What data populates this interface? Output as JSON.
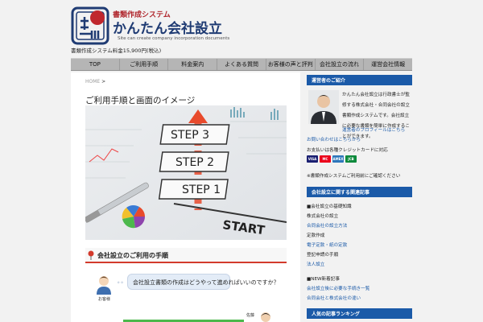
{
  "header": {
    "logo_stamp_text": "書類",
    "subtitle": "書類作成システム",
    "title": "かんたん会社設立",
    "tagline": "Site can create company incorporation documents",
    "price_note": "書類作成システム料金15,900円(税込)"
  },
  "nav": {
    "items": [
      "TOP",
      "ご利用手順",
      "料金案内",
      "よくある質問",
      "お客様の声と評判",
      "会社設立の流れ",
      "運営会社情報"
    ]
  },
  "main": {
    "breadcrumb_home": "HOME",
    "breadcrumb_sep": ">",
    "page_title": "ご利用手順と画面のイメージ",
    "hero_steps": [
      "STEP 3",
      "STEP 2",
      "STEP 1",
      "START"
    ],
    "section_title": "会社設立のご利用の手順",
    "dialog": {
      "left_name": "お客様",
      "left_text": "会社設立書類の作成はどうやって進めればいいのですか？",
      "right_name": "佐藤"
    }
  },
  "sidebar": {
    "head1": "運営者のご紹介",
    "profile_text": "かんたん会社設立は行政書士が監修する株式会社・合同会社の設立書類作成システムです。会社設立に必要な書類を簡単に作成することができます。",
    "profile_link": "運営者のプロフィールはこちら",
    "link_contact": "お問い合わせはこちらから",
    "payment_label": "お支払いは各種クレジットカードに対応",
    "cards": [
      "VISA",
      "MC",
      "AMEX",
      "JCB"
    ],
    "note": "※書類作成システムご利用前にご確認ください",
    "head2": "会社設立に関する関連記事",
    "list": [
      {
        "text": "■会社設立の基礎知識",
        "type": "text"
      },
      {
        "text": "株式会社の設立",
        "type": "text"
      },
      {
        "text": "合同会社の設立方法",
        "type": "link"
      },
      {
        "text": "定款作成",
        "type": "text"
      },
      {
        "text": "電子定款・紙の定款",
        "type": "link"
      },
      {
        "text": "登記申請の手順",
        "type": "text"
      },
      {
        "text": "法人設立",
        "type": "link"
      },
      {
        "text": "■NEW新着記事",
        "type": "text"
      },
      {
        "text": "会社設立後に必要な手続き一覧",
        "type": "link"
      },
      {
        "text": "合同会社と株式会社の違い",
        "type": "link"
      }
    ],
    "head3": "人気の記事ランキング"
  },
  "colors": {
    "nav_bg": "#b5b5b5",
    "side_head_bg": "#1b5aa8",
    "accent_red": "#d33a2c",
    "bubble_bg": "#e3ecf7",
    "green_bar": "#4cb84c"
  }
}
